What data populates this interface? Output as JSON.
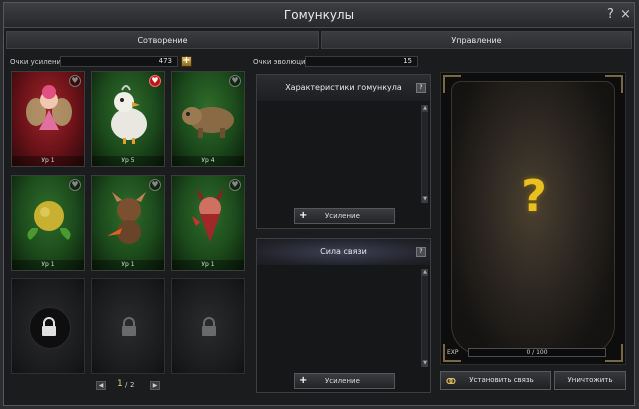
{
  "window": {
    "title": "Гомункулы",
    "help_glyph": "?",
    "close_glyph": "×"
  },
  "tabs": [
    {
      "label": "Сотворение"
    },
    {
      "label": "Управление"
    }
  ],
  "stats": {
    "boost_points_label": "Очки усиления",
    "boost_points_value": "473",
    "add_glyph": "+",
    "evolution_points_label": "Очки эволюции",
    "evolution_points_value": "15"
  },
  "cards": [
    {
      "level": "Ур 1",
      "bg": "red",
      "favorite": false,
      "icon": "fairy-icon"
    },
    {
      "level": "Ур 5",
      "bg": "green",
      "favorite": true,
      "icon": "chick-icon"
    },
    {
      "level": "Ур 4",
      "bg": "green",
      "favorite": false,
      "icon": "boar-icon"
    },
    {
      "level": "Ур 1",
      "bg": "green",
      "favorite": false,
      "icon": "seed-icon"
    },
    {
      "level": "Ур 1",
      "bg": "green",
      "favorite": false,
      "icon": "beast-icon"
    },
    {
      "level": "Ур 1",
      "bg": "green",
      "favorite": false,
      "icon": "imp-icon"
    }
  ],
  "pager": {
    "current": "1",
    "separator": "/",
    "total": "2",
    "prev_glyph": "◀",
    "next_glyph": "▶"
  },
  "panels": {
    "characteristics": {
      "title": "Характеристики гомункула",
      "button_label": "Усиление",
      "button_glyph": "+",
      "help_glyph": "?"
    },
    "bond": {
      "title": "Сила связи",
      "button_label": "Усиление",
      "button_glyph": "+",
      "help_glyph": "?"
    }
  },
  "jar": {
    "mystery_glyph": "?",
    "exp_label": "EXP",
    "exp_value": "0 / 100",
    "exp_progress": 0
  },
  "buttons": {
    "bond": "Установить связь",
    "destroy": "Уничтожить"
  },
  "colors": {
    "accent_gold": "#d8b45a",
    "card_red": "#8a1a20",
    "card_green": "#245a22",
    "mystery_yellow": "#e8c020"
  }
}
